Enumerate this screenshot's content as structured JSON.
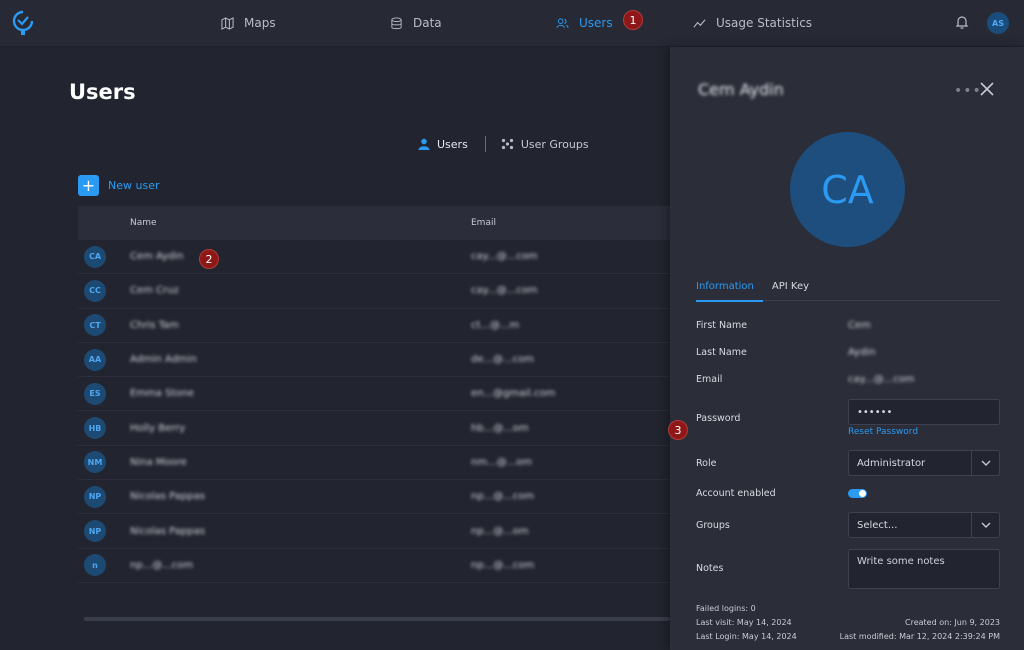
{
  "nav": {
    "items": [
      {
        "label": "Maps",
        "icon": "map-icon"
      },
      {
        "label": "Data",
        "icon": "database-icon"
      },
      {
        "label": "Users",
        "icon": "users-icon",
        "active": true
      },
      {
        "label": "Usage Statistics",
        "icon": "trend-icon"
      }
    ],
    "user_initials": "AS"
  },
  "badges": {
    "one": "1",
    "two": "2",
    "three": "3"
  },
  "main": {
    "title": "Users",
    "toggle": {
      "users": "Users",
      "groups": "User Groups"
    },
    "new_user": "New user"
  },
  "table": {
    "headers": {
      "name": "Name",
      "email": "Email"
    },
    "rows": [
      {
        "initials": "CA",
        "name": "Cem Aydin",
        "email": "cay...@...com"
      },
      {
        "initials": "CC",
        "name": "Cem Cruz",
        "email": "cay...@...com"
      },
      {
        "initials": "CT",
        "name": "Chris Tam",
        "email": "ct...@...m"
      },
      {
        "initials": "AA",
        "name": "Admin Admin",
        "email": "de...@...com"
      },
      {
        "initials": "ES",
        "name": "Emma Stone",
        "email": "en...@gmail.com"
      },
      {
        "initials": "HB",
        "name": "Holly Berry",
        "email": "hb...@...om"
      },
      {
        "initials": "NM",
        "name": "Nina Moore",
        "email": "nm...@...om"
      },
      {
        "initials": "NP",
        "name": "Nicolas Pappas",
        "email": "np...@...com"
      },
      {
        "initials": "NP",
        "name": "Nicolas Pappas",
        "email": "np...@...om"
      },
      {
        "initials": "n",
        "name": "np...@...com",
        "email": "np...@...com"
      }
    ]
  },
  "panel": {
    "title": "Cem Aydin",
    "initials": "CA",
    "tabs": [
      "Information",
      "API Key"
    ],
    "fields": {
      "first_name_label": "First Name",
      "first_name": "Cem",
      "last_name_label": "Last Name",
      "last_name": "Aydin",
      "email_label": "Email",
      "email": "cay...@...com",
      "password_label": "Password",
      "password": "••••••",
      "reset_password": "Reset Password",
      "role_label": "Role",
      "role": "Administrator",
      "enabled_label": "Account enabled",
      "groups_label": "Groups",
      "groups_placeholder": "Select...",
      "notes_label": "Notes",
      "notes_placeholder": "Write some notes"
    },
    "meta": {
      "failed_logins": "Failed logins: 0",
      "last_visit": "Last visit: May 14, 2024",
      "last_login": "Last Login: May 14, 2024",
      "created_on": "Created on: Jun 9, 2023",
      "last_modified": "Last modified: Mar 12, 2024 2:39:24 PM"
    }
  },
  "colors": {
    "accent": "#2b9af3",
    "background": "#22252f",
    "panel": "#2b2e38",
    "badge": "#8e1818"
  }
}
